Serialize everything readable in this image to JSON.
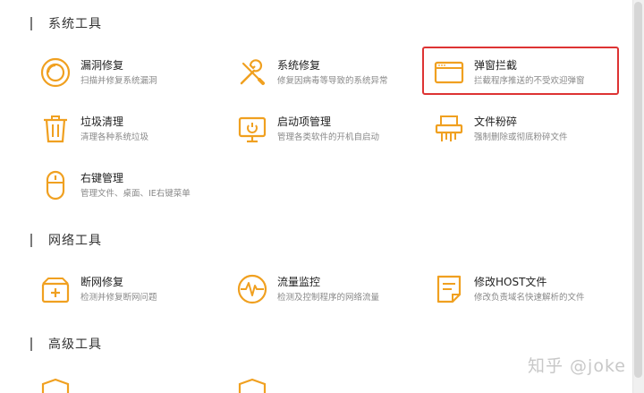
{
  "sections": {
    "system": "系统工具",
    "network": "网络工具",
    "advanced": "高级工具"
  },
  "tools": {
    "vuln": {
      "name": "漏洞修复",
      "desc": "扫描并修复系统漏洞",
      "icon": "ring-icon"
    },
    "sysfix": {
      "name": "系统修复",
      "desc": "修复因病毒等导致的系统异常",
      "icon": "wrench-screwdriver-icon"
    },
    "popup": {
      "name": "弹窗拦截",
      "desc": "拦截程序推送的不受欢迎弹窗",
      "icon": "window-icon"
    },
    "junk": {
      "name": "垃圾清理",
      "desc": "清理各种系统垃圾",
      "icon": "trash-icon"
    },
    "startup": {
      "name": "启动项管理",
      "desc": "管理各类软件的开机自启动",
      "icon": "monitor-power-icon"
    },
    "shred": {
      "name": "文件粉碎",
      "desc": "强制删除或彻底粉碎文件",
      "icon": "shredder-icon"
    },
    "rightclick": {
      "name": "右键管理",
      "desc": "管理文件、桌面、IE右键菜单",
      "icon": "mouse-icon"
    },
    "netfix": {
      "name": "断网修复",
      "desc": "检测并修复断网问题",
      "icon": "plus-box-icon"
    },
    "traffic": {
      "name": "流量监控",
      "desc": "检测及控制程序的网络流量",
      "icon": "pulse-icon"
    },
    "host": {
      "name": "修改HOST文件",
      "desc": "修改负责域名快速解析的文件",
      "icon": "document-icon"
    },
    "adv1": {
      "name": "",
      "icon": "shield-icon"
    },
    "adv2": {
      "name": "",
      "icon": "shield-icon"
    }
  },
  "watermark": "知乎 @joke",
  "colors": {
    "accent": "#f0a020",
    "highlight": "#dd3333"
  }
}
